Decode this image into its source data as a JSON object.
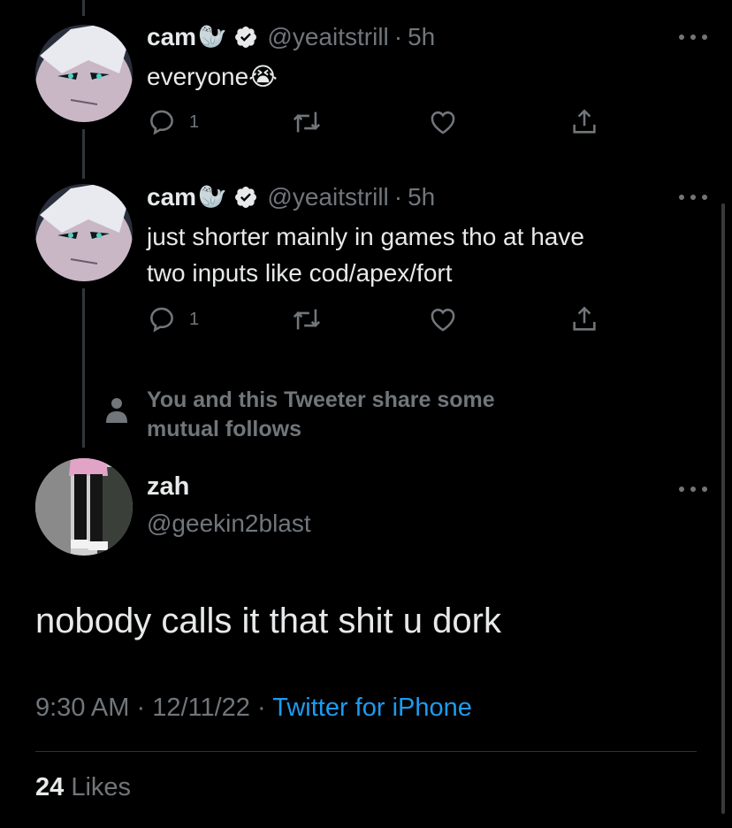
{
  "tweets": [
    {
      "name": "cam",
      "emoji": "🦭",
      "handle": "@yeaitstrill",
      "separator": "·",
      "time": "5h",
      "text_lines": [
        "everyone😭"
      ],
      "reply_count": "1"
    },
    {
      "name": "cam",
      "emoji": "🦭",
      "handle": "@yeaitstrill",
      "separator": "·",
      "time": "5h",
      "text_lines": [
        "just shorter mainly in games tho at have",
        "two inputs like cod/apex/fort"
      ],
      "reply_count": "1"
    }
  ],
  "social_context": {
    "line1": "You and this Tweeter share some",
    "line2": "mutual follows"
  },
  "focused_tweet": {
    "name": "zah",
    "handle": "@geekin2blast",
    "text": "nobody calls it that shit u dork",
    "time": "9:30 AM",
    "sep1": "·",
    "date": "12/11/22",
    "sep2": "·",
    "source": "Twitter for iPhone",
    "likes_count": "24",
    "likes_label": "Likes"
  },
  "colors": {
    "background": "#000000",
    "text": "#e7e9ea",
    "muted": "#71767b",
    "link": "#1d9bf0"
  },
  "icons": [
    "verified-badge-icon",
    "reply-icon",
    "retweet-icon",
    "like-icon",
    "share-icon",
    "more-icon",
    "person-icon"
  ]
}
